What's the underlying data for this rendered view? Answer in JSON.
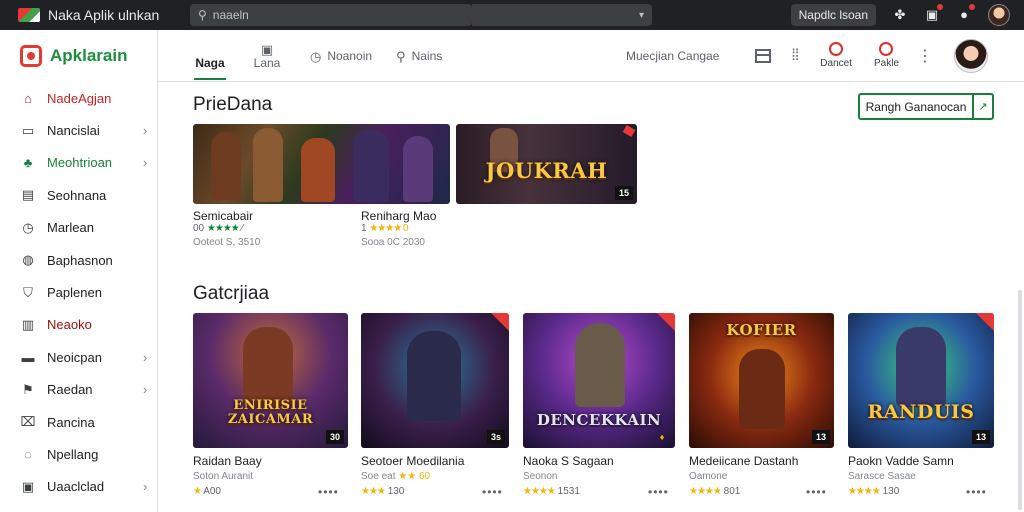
{
  "topbar": {
    "title": "Naka Aplik ulnkan",
    "search_placeholder": "naaeln",
    "user_label": "Napdlc lsoan"
  },
  "sidebar": {
    "brand": "Apklarain",
    "items": [
      {
        "label": "NadeAgjan",
        "icon": "home-icon",
        "chevron": false,
        "style": "active"
      },
      {
        "label": "Nancislai",
        "icon": "grid-icon",
        "chevron": true,
        "style": ""
      },
      {
        "label": "Meohtrioan",
        "icon": "users-icon",
        "chevron": true,
        "style": "green"
      },
      {
        "label": "Seohnana",
        "icon": "list-icon",
        "chevron": false,
        "style": ""
      },
      {
        "label": "Marlean",
        "icon": "clock-icon",
        "chevron": false,
        "style": ""
      },
      {
        "label": "Baphasnon",
        "icon": "gamepad-icon",
        "chevron": false,
        "style": ""
      },
      {
        "label": "Paplenen",
        "icon": "shield-icon",
        "chevron": false,
        "style": ""
      },
      {
        "label": "Neaoko",
        "icon": "bars-icon",
        "chevron": false,
        "style": "red"
      },
      {
        "label": "Neoicpan",
        "icon": "folder-icon",
        "chevron": true,
        "style": ""
      },
      {
        "label": "Raedan",
        "icon": "flag-icon",
        "chevron": true,
        "style": ""
      },
      {
        "label": "Rancina",
        "icon": "tag-icon",
        "chevron": false,
        "style": ""
      },
      {
        "label": "Npellang",
        "icon": "chat-icon",
        "chevron": false,
        "style": ""
      },
      {
        "label": "Uaaclclad",
        "icon": "calendar-icon",
        "chevron": true,
        "style": ""
      }
    ]
  },
  "tabs": [
    {
      "label": "Naga",
      "icon": "",
      "active": true
    },
    {
      "label": "Lana",
      "icon": "image-icon",
      "active": false
    },
    {
      "label": "Noanoin",
      "icon": "clock-icon",
      "active": false
    },
    {
      "label": "Nains",
      "icon": "puzzle-icon",
      "active": false
    }
  ],
  "tabs_right": {
    "text": "Muecjian Cangae",
    "action1": "Dancet",
    "action2": "Pakle"
  },
  "section1": {
    "title": "PrieDana",
    "button": "Rangh Gananocan",
    "cards": [
      {
        "title": "Semicabair",
        "stars": "★★★★",
        "rating": "00",
        "rating_suffix": "⁄",
        "meta": "Ooteot S, 3510",
        "logo": ""
      },
      {
        "title": "Reniharg Mao",
        "stars": "",
        "rating": "1",
        "rating_suffix": "★★★★ 0",
        "meta": "Sooa 0C 2030",
        "logo": "JOUKRAH",
        "badge": "15"
      }
    ]
  },
  "section2": {
    "title": "Gatcrjiaa",
    "cards": [
      {
        "title": "Raidan Baay",
        "stars": "★",
        "rating": "",
        "score": "A00",
        "meta": "Soton Auranit",
        "logo": "ENIRISIE ZAICAMAR",
        "badge": "30"
      },
      {
        "title": "Seotoer Moedilania",
        "stars": "★★★",
        "rating": "",
        "score": "130",
        "meta": "Soe eat",
        "meta_extra": "★★ 60",
        "logo": "",
        "badge": "3s"
      },
      {
        "title": "Naoka S Sagaan",
        "stars": "★★★★",
        "rating": "",
        "score": "1531",
        "meta": "Seonon",
        "logo": "DENCEKKAIN",
        "badge": "♦"
      },
      {
        "title": "Medeiicane Dastanh",
        "stars": "★★★★",
        "rating": "",
        "score": "801",
        "meta": "Oamone",
        "logo": "KOFIER",
        "badge": "13"
      },
      {
        "title": "Paokn Vadde Samn",
        "stars": "★★★★",
        "rating": "",
        "score": "130",
        "meta": "Sarasce Sasae",
        "logo": "RANDUIS",
        "badge": "13"
      }
    ]
  }
}
